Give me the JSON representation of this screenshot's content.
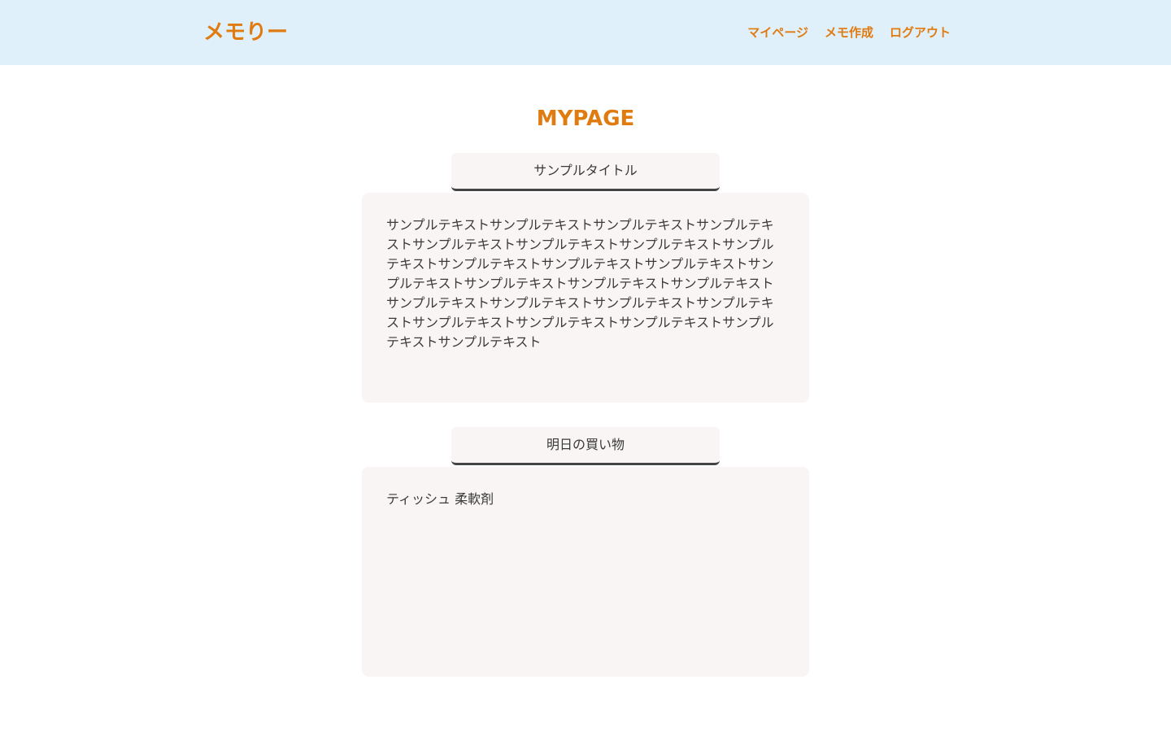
{
  "header": {
    "logo": "メモりー",
    "nav": {
      "mypage": "マイページ",
      "create": "メモ作成",
      "logout": "ログアウト"
    }
  },
  "main": {
    "title": "MYPAGE",
    "memos": [
      {
        "title": "サンプルタイトル",
        "body": "サンプルテキストサンプルテキストサンプルテキストサンプルテキストサンプルテキストサンプルテキストサンプルテキストサンプルテキストサンプルテキストサンプルテキストサンプルテキストサンプルテキストサンプルテキストサンプルテキストサンプルテキストサンプルテキストサンプルテキストサンプルテキストサンプルテキストサンプルテキストサンプルテキストサンプルテキストサンプルテキストサンプルテキスト"
      },
      {
        "title": "明日の買い物",
        "body": "ティッシュ 柔軟剤"
      }
    ]
  },
  "colors": {
    "accent": "#e07b10",
    "header_bg": "#e0f0fb",
    "card_bg": "#f9f5f5"
  }
}
